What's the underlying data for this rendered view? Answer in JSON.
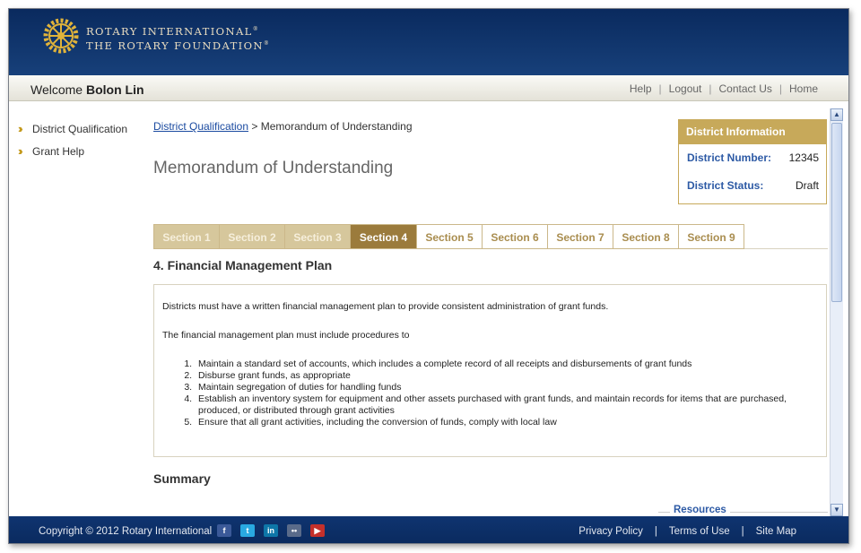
{
  "header": {
    "org_line1": "ROTARY INTERNATIONAL",
    "org_line2": "THE ROTARY FOUNDATION",
    "reg_mark": "®"
  },
  "welcome": {
    "prefix": "Welcome",
    "user": "Bolon Lin"
  },
  "toplinks": [
    "Help",
    "Logout",
    "Contact Us",
    "Home"
  ],
  "sidebar": {
    "items": [
      {
        "label": "District Qualification",
        "icon": "double-chevron-right-icon"
      },
      {
        "label": "Grant Help",
        "icon": "double-chevron-right-icon"
      }
    ]
  },
  "breadcrumb": {
    "link": "District Qualification",
    "separator": ">",
    "current": "Memorandum of Understanding"
  },
  "page_title": "Memorandum of Understanding",
  "district_info": {
    "title": "District Information",
    "number_label": "District Number:",
    "number_value": "12345",
    "status_label": "District Status:",
    "status_value": "Draft"
  },
  "tabs": [
    {
      "label": "Section 1",
      "state": "done"
    },
    {
      "label": "Section 2",
      "state": "done"
    },
    {
      "label": "Section 3",
      "state": "done"
    },
    {
      "label": "Section 4",
      "state": "active"
    },
    {
      "label": "Section 5",
      "state": "todo"
    },
    {
      "label": "Section 6",
      "state": "todo"
    },
    {
      "label": "Section 7",
      "state": "todo"
    },
    {
      "label": "Section 8",
      "state": "todo"
    },
    {
      "label": "Section 9",
      "state": "todo"
    }
  ],
  "section": {
    "title": "4. Financial Management Plan",
    "intro": "Districts must have a written financial management plan to provide consistent administration of grant funds.",
    "lead": "The financial management plan must include procedures to",
    "items": [
      "Maintain a standard set of accounts, which includes a complete record of all receipts and disbursements of grant funds",
      "Disburse grant funds, as appropriate",
      "Maintain segregation of duties for handling funds",
      "Establish an inventory system for equipment and other assets purchased with grant funds, and maintain records for items that are purchased, produced, or distributed through grant activities",
      "Ensure that all grant activities, including the conversion of funds, comply with local law"
    ]
  },
  "summary_title": "Summary",
  "resources_title": "Resources",
  "footer": {
    "copyright": "Copyright © 2012 Rotary International",
    "links": [
      "Privacy Policy",
      "Terms of Use",
      "Site Map"
    ]
  },
  "colors": {
    "header_navy": "#0a2a5e",
    "gold": "#c7a95a",
    "active_tab": "#9b7b3c",
    "link_blue": "#1a4aa0"
  }
}
